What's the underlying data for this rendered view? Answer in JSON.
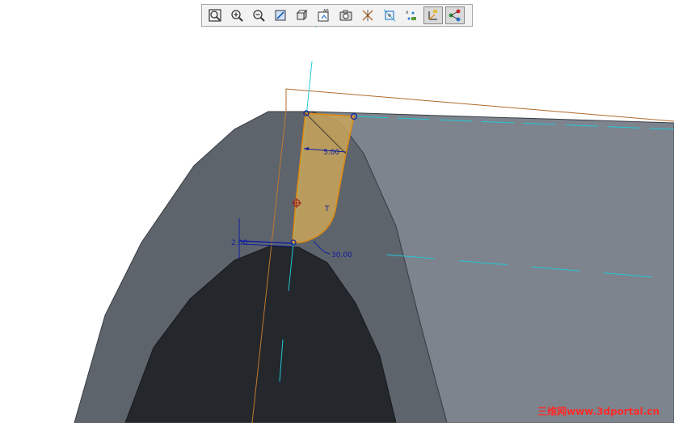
{
  "toolbar": {
    "buttons": [
      {
        "name": "zoom-fit",
        "icon": "zoom-fit-icon"
      },
      {
        "name": "zoom-in",
        "icon": "zoom-in-icon"
      },
      {
        "name": "zoom-out",
        "icon": "zoom-out-icon"
      },
      {
        "name": "repaint",
        "icon": "repaint-icon"
      },
      {
        "name": "display-style",
        "icon": "cube-icon"
      },
      {
        "name": "saved-views",
        "icon": "saved-views-icon"
      },
      {
        "name": "view-manager",
        "icon": "camera-icon"
      },
      {
        "name": "datum-planes",
        "icon": "datum-planes-icon"
      },
      {
        "name": "datum-axes",
        "icon": "datum-axes-icon"
      },
      {
        "name": "datum-points",
        "icon": "datum-points-icon"
      },
      {
        "name": "csys-display",
        "icon": "csys-icon"
      },
      {
        "name": "annotation-display",
        "icon": "annotation-icon"
      }
    ]
  },
  "sketch": {
    "dim_width": "5.00",
    "dim_angle": "30.00",
    "dim_offset": "2.00",
    "constraint_label": "T"
  },
  "watermark": "三维网www.3dportal.cn",
  "colors": {
    "background": "#ffffff",
    "part_light": "#7d848d",
    "part_dark": "#5e646c",
    "hole": "#24272b",
    "sketch_fill": "#c8a45a",
    "dimension": "#1020a0",
    "axis": "#22c8d8",
    "datum_plane": "#b06a2a"
  }
}
